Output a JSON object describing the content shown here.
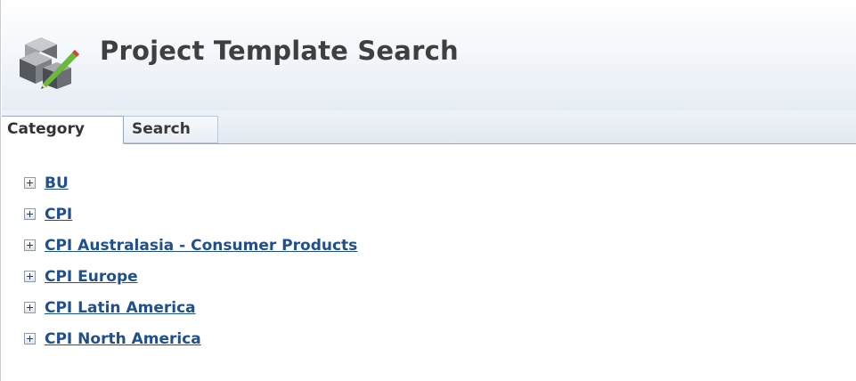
{
  "header": {
    "title": "Project Template Search",
    "icon": "blocks-pencil-icon"
  },
  "tabs": [
    {
      "label": "Category",
      "selected": true
    },
    {
      "label": "Search",
      "selected": false
    }
  ],
  "tree": {
    "expand_icon": "plus-box-icon",
    "items": [
      {
        "label": "BU"
      },
      {
        "label": "CPI"
      },
      {
        "label": "CPI Australasia - Consumer Products"
      },
      {
        "label": "CPI Europe"
      },
      {
        "label": "CPI Latin America"
      },
      {
        "label": "CPI North America"
      }
    ]
  },
  "colors": {
    "link": "#1f4f8f",
    "title": "#3f3f3f",
    "tab_border": "#93a8c2"
  }
}
